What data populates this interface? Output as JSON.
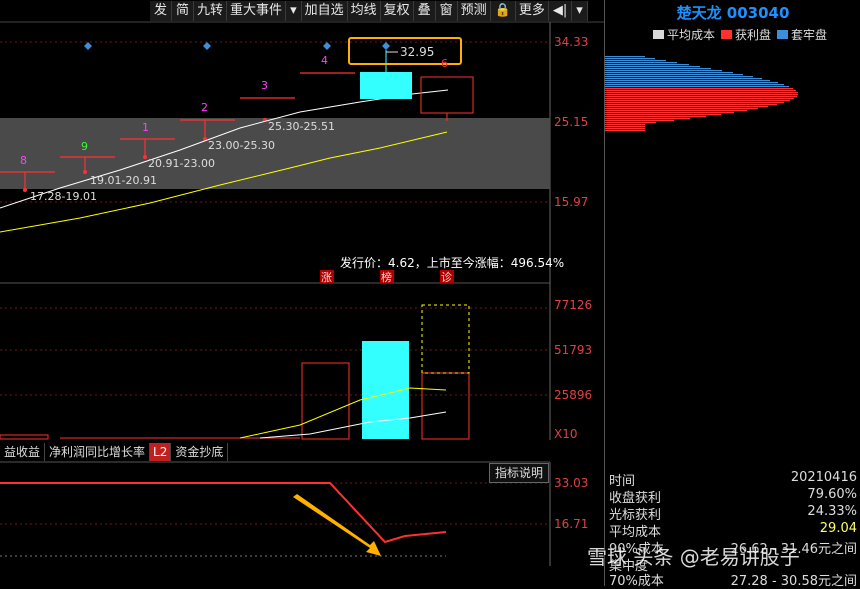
{
  "toolbar": {
    "items": [
      "发",
      "简",
      "九转",
      "重大事件",
      "▾",
      "加自选",
      "均线",
      "复权",
      "叠",
      "窗",
      "预测",
      "🔒",
      "更多",
      "◀|",
      "▾"
    ]
  },
  "stock": {
    "name_code": "楚天龙 003040"
  },
  "legend": {
    "items": [
      {
        "label": "平均成本",
        "color": "#d8d8d8"
      },
      {
        "label": "获利盘",
        "color": "#ff3030"
      },
      {
        "label": "套牢盘",
        "color": "#3a8fd8"
      }
    ]
  },
  "main_chart": {
    "price_labels": [
      "34.33",
      "25.15",
      "15.97"
    ],
    "callout_price": "32.95",
    "board_numbers": [
      "8",
      "9",
      "1",
      "2",
      "3",
      "4",
      "6"
    ],
    "range_labels": [
      "17.28-19.01",
      "19.01-20.91",
      "20.91-23.00",
      "23.00-25.30",
      "25.30-25.51"
    ],
    "ipo_text": "发行价：4.62，上市至今涨幅：496.54%",
    "markers": [
      "涨",
      "榜",
      "诊"
    ]
  },
  "volume_chart": {
    "labels": [
      "77126",
      "51793",
      "25896",
      "X10"
    ]
  },
  "tabs": [
    "益收益",
    "净利润同比增长率",
    "L2",
    "资金抄底"
  ],
  "indicator": {
    "button": "指标说明",
    "labels": [
      "33.03",
      "16.71"
    ]
  },
  "stats": {
    "rows": [
      {
        "k": "时间",
        "v": "20210416"
      },
      {
        "k": "收盘获利",
        "v": "79.60%"
      },
      {
        "k": "光标获利",
        "v": "24.33%"
      },
      {
        "k": "平均成本",
        "v": "29.04"
      },
      {
        "k": "90%成本",
        "v": "26.62 - 31.46元之间"
      },
      {
        "k": "集中度",
        "v": ""
      },
      {
        "k": "70%成本",
        "v": "27.28 - 30.58元之间"
      }
    ]
  },
  "watermark": "雪球 头条 @老易讲股子",
  "colors": {
    "up": "#ff3030",
    "cyan": "#33ffff",
    "yellow": "#ffff00",
    "blue": "#1e90ff",
    "orange": "#ffb000"
  }
}
